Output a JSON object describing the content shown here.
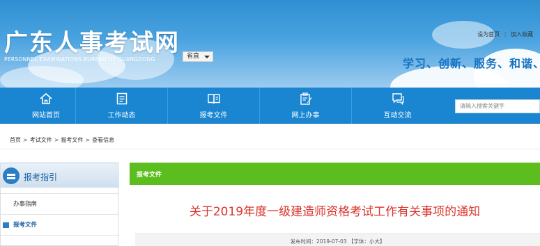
{
  "header": {
    "title": "广东人事考试网",
    "subtitle": "PERSONNEL EXAMINATIONS BUREAU OF GUANGDONG",
    "province_select": "省直",
    "links": {
      "set_home": "设为首页",
      "separator": "|",
      "add_favorite": "加入收藏"
    },
    "slogan": "学习、创新、服务、和谐、"
  },
  "nav": {
    "items": [
      {
        "label": "网站首页",
        "icon": "home-icon"
      },
      {
        "label": "工作动态",
        "icon": "document-list-icon"
      },
      {
        "label": "报考文件",
        "icon": "open-book-icon"
      },
      {
        "label": "网上办事",
        "icon": "clipboard-edit-icon"
      },
      {
        "label": "互动交流",
        "icon": "chat-bubbles-icon"
      }
    ],
    "search_placeholder": "请输入搜索关键字"
  },
  "breadcrumb": {
    "items": [
      "首页",
      "考试文件",
      "报考文件",
      "查看信息"
    ],
    "separator": ">"
  },
  "sidebar": {
    "title": "报考指引",
    "items": [
      {
        "label": "办事指南",
        "active": false
      },
      {
        "label": "报考文件",
        "active": true
      }
    ]
  },
  "content": {
    "section_label": "报考文件",
    "article_title": "关于2019年度一级建造师资格考试工作有关事项的通知",
    "meta": "发布时间：2019-07-03  【字体：小大】"
  },
  "colors": {
    "nav_blue": "#1a86d2",
    "section_green": "#5cbd1e",
    "title_red": "#d9342b",
    "slogan_blue": "#1572c0"
  }
}
